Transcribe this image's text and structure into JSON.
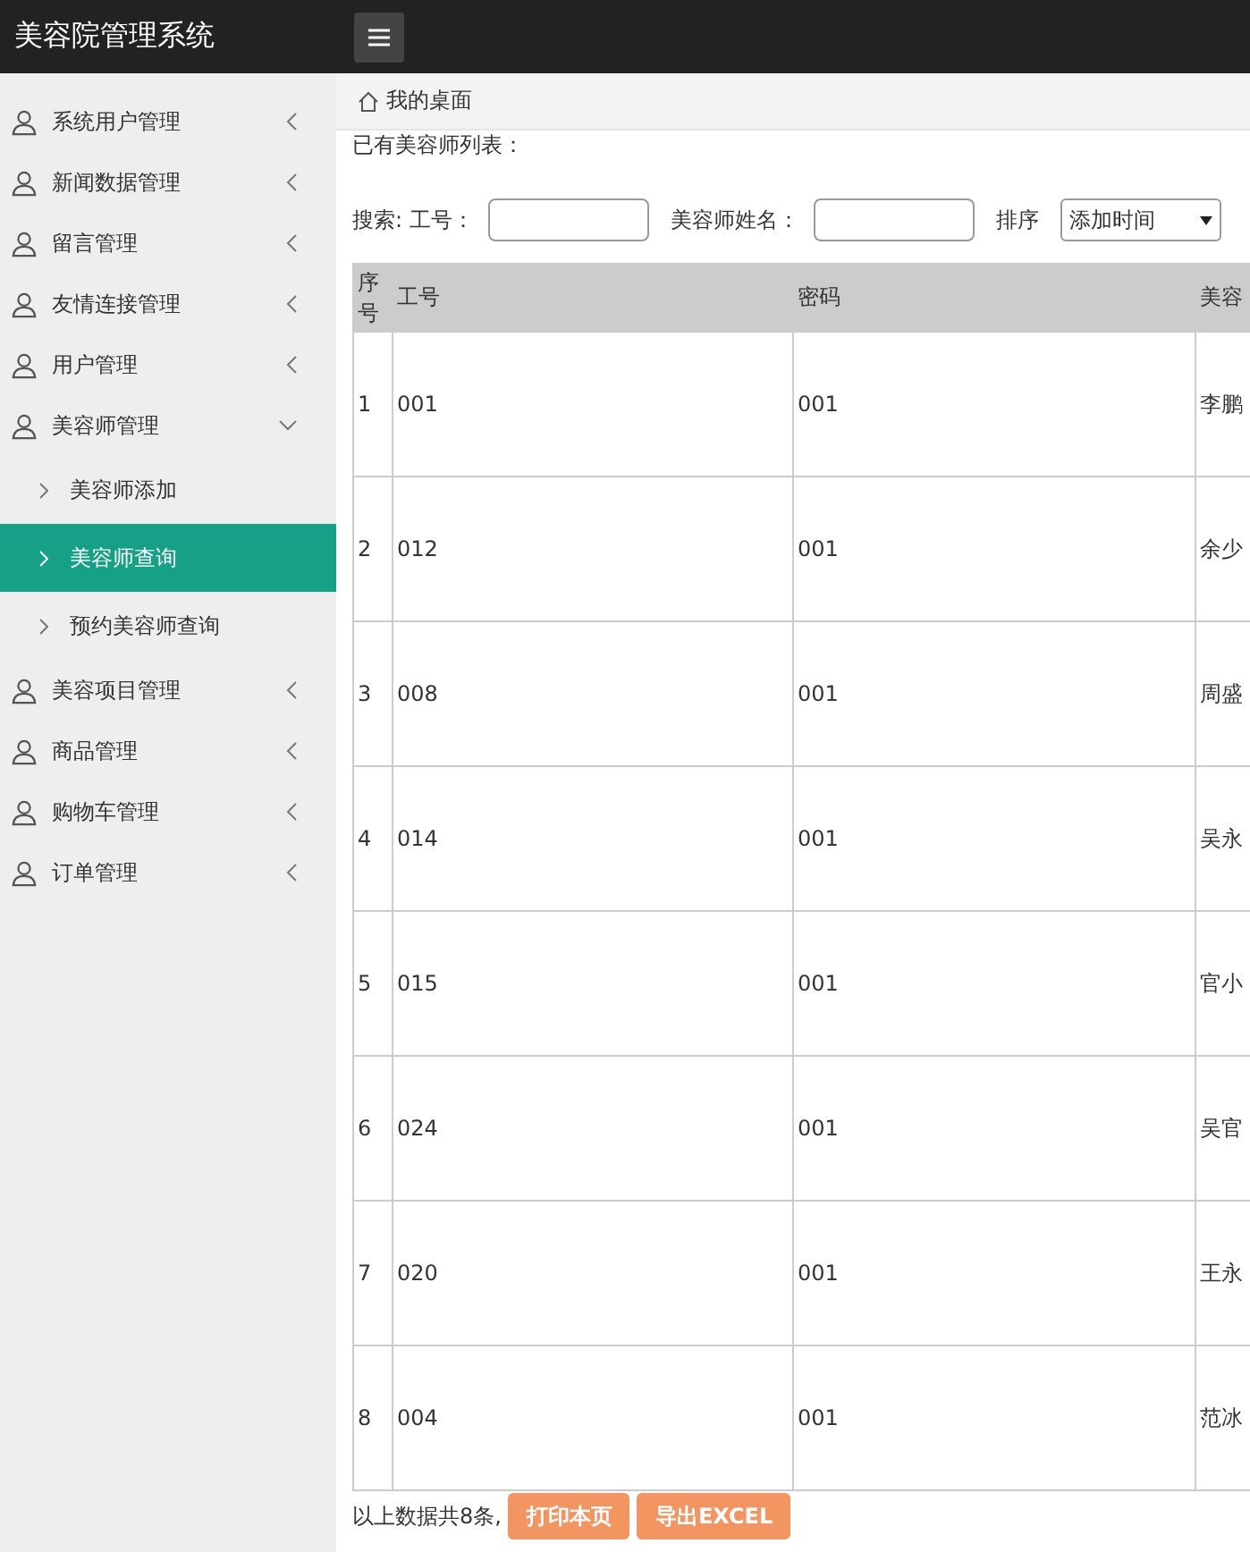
{
  "header": {
    "title": "美容院管理系统"
  },
  "sidebar": {
    "items": [
      {
        "label": "系统用户管理",
        "expanded": false
      },
      {
        "label": "新闻数据管理",
        "expanded": false
      },
      {
        "label": "留言管理",
        "expanded": false
      },
      {
        "label": "友情连接管理",
        "expanded": false
      },
      {
        "label": "用户管理",
        "expanded": false
      },
      {
        "label": "美容师管理",
        "expanded": true,
        "children": [
          {
            "label": "美容师添加",
            "selected": false
          },
          {
            "label": "美容师查询",
            "selected": true
          },
          {
            "label": "预约美容师查询",
            "selected": false
          }
        ]
      },
      {
        "label": "美容项目管理",
        "expanded": false
      },
      {
        "label": "商品管理",
        "expanded": false
      },
      {
        "label": "购物车管理",
        "expanded": false
      },
      {
        "label": "订单管理",
        "expanded": false
      }
    ]
  },
  "breadcrumb": "我的桌面",
  "list_title": "已有美容师列表：",
  "search": {
    "label": "搜索: 工号：",
    "name_label": "美容师姓名：",
    "sort_label": "排序",
    "sort_value": "添加时间"
  },
  "table": {
    "columns": [
      "序号",
      "工号",
      "密码",
      "美容"
    ],
    "rows": [
      [
        "1",
        "001",
        "001",
        "李鹏"
      ],
      [
        "2",
        "012",
        "001",
        "余少"
      ],
      [
        "3",
        "008",
        "001",
        "周盛"
      ],
      [
        "4",
        "014",
        "001",
        "吴永"
      ],
      [
        "5",
        "015",
        "001",
        "官小"
      ],
      [
        "6",
        "024",
        "001",
        "吴官"
      ],
      [
        "7",
        "020",
        "001",
        "王永"
      ],
      [
        "8",
        "004",
        "001",
        "范冰"
      ]
    ]
  },
  "footer": {
    "summary": "以上数据共8条,",
    "buttons": [
      "打印本页",
      "导出EXCEL"
    ]
  }
}
